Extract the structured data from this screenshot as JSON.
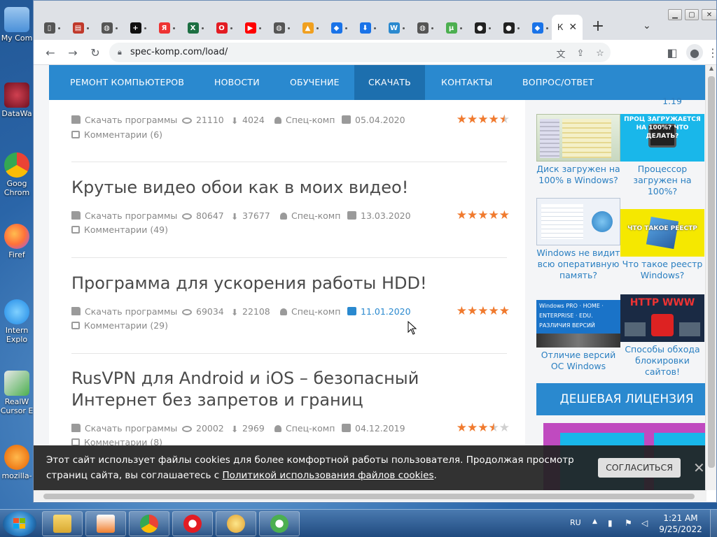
{
  "desktop": {
    "icons": [
      {
        "label": "My Com",
        "color": "#4a90d9"
      },
      {
        "label": "DataWa",
        "color": "#b03040"
      },
      {
        "label": "Goog Chrom",
        "color": "#34a853"
      },
      {
        "label": "Firef",
        "color": "#ff7139"
      },
      {
        "label": "Intern Explo",
        "color": "#1e88e5"
      },
      {
        "label": "RealW Cursor E",
        "color": "#2e7d32"
      },
      {
        "label": "mozilla-",
        "color": "#e66000"
      }
    ]
  },
  "browser": {
    "active_tab_label": "К",
    "url": "spec-komp.com/load/",
    "tabs": [
      {
        "icon": "notebook-icon",
        "color": "#555",
        "glyph": "▯"
      },
      {
        "icon": "books-icon",
        "color": "#c0392b",
        "glyph": "▤"
      },
      {
        "icon": "globe-icon",
        "color": "#555",
        "glyph": "◍"
      },
      {
        "icon": "plus-circle-icon",
        "color": "#111",
        "glyph": "+"
      },
      {
        "icon": "yandex-icon",
        "color": "#e33",
        "glyph": "Я"
      },
      {
        "icon": "excel-icon",
        "color": "#1d6f42",
        "glyph": "X"
      },
      {
        "icon": "opera-icon",
        "color": "#e31c23",
        "glyph": "O"
      },
      {
        "icon": "youtube-icon",
        "color": "#ff0000",
        "glyph": "▶"
      },
      {
        "icon": "globe-icon",
        "color": "#555",
        "glyph": "◍"
      },
      {
        "icon": "image-icon",
        "color": "#f0a020",
        "glyph": "▲"
      },
      {
        "icon": "shield-icon",
        "color": "#1a73e8",
        "glyph": "◆"
      },
      {
        "icon": "download-icon",
        "color": "#1a73e8",
        "glyph": "⬇"
      },
      {
        "icon": "w-logo-icon",
        "color": "#2a89cf",
        "glyph": "W"
      },
      {
        "icon": "globe-icon",
        "color": "#555",
        "glyph": "◍"
      },
      {
        "icon": "utorrent-icon",
        "color": "#4caf50",
        "glyph": "μ"
      },
      {
        "icon": "github-icon",
        "color": "#222",
        "glyph": "●"
      },
      {
        "icon": "github-icon",
        "color": "#222",
        "glyph": "●"
      },
      {
        "icon": "diamond-icon",
        "color": "#1a73e8",
        "glyph": "◆"
      }
    ]
  },
  "site": {
    "nav": [
      "РЕМОНТ КОМПЬЮТЕРОВ",
      "НОВОСТИ",
      "ОБУЧЕНИЕ",
      "СКАЧАТЬ",
      "КОНТАКТЫ",
      "ВОПРОС/ОТВЕТ"
    ],
    "nav_active_index": 3,
    "posts": [
      {
        "title": "",
        "category": "Скачать программы",
        "views": "21110",
        "downloads": "4024",
        "author": "Спец-комп",
        "date": "05.04.2020",
        "comments": "Комментарии (6)",
        "rating": 4.5
      },
      {
        "title": "Крутые видео обои как в моих видео!",
        "category": "Скачать программы",
        "views": "80647",
        "downloads": "37677",
        "author": "Спец-комп",
        "date": "13.03.2020",
        "comments": "Комментарии (49)",
        "rating": 5
      },
      {
        "title": "Программа для ускорения работы HDD!",
        "category": "Скачать программы",
        "views": "69034",
        "downloads": "22108",
        "author": "Спец-комп",
        "date": "11.01.2020",
        "date_highlight": true,
        "comments": "Комментарии (29)",
        "rating": 5
      },
      {
        "title": "RusVPN для Android и iOS – безопасный Интернет без запретов и границ",
        "category": "Скачать программы",
        "views": "20002",
        "downloads": "2969",
        "author": "Спец-комп",
        "date": "04.12.2019",
        "comments": "Комментарии (8)",
        "rating": 3.5
      }
    ],
    "sidebar": {
      "top_caption_right": "1.19",
      "thumbs": [
        {
          "caption": "Диск загружен на 100% в Windows?",
          "img_text": ""
        },
        {
          "caption": "Процессор загружен на 100%?",
          "img_text": "ПРОЦ ЗАГРУЖАЕТСЯ НА 100%? ЧТО ДЕЛАТЬ?"
        },
        {
          "caption": "Windows не видит всю оперативную память?",
          "img_text": ""
        },
        {
          "caption": "Что такое реестр Windows?",
          "img_text": "ЧТО ТАКОЕ РЕЕСТР WINDOWS?"
        },
        {
          "caption": "Отличие версий ОС Windows",
          "img_text": "Windows PRO · HOME · ENTERPRISE · EDU. РАЗЛИЧИЯ ВЕРСИЙ"
        },
        {
          "caption": "Способы обхода блокировки сайтов!",
          "img_text": "HTTP WWW"
        }
      ],
      "license_label": "ДЕШЕВАЯ ЛИЦЕНЗИЯ"
    },
    "cookie": {
      "text_before": "Этот сайт использует файлы cookies для более комфортной работы пользователя. Продолжая просмотр страниц сайта, вы соглашаетесь с ",
      "link": "Политикой использования файлов cookies",
      "text_after": ".",
      "agree": "СОГЛАСИТЬСЯ",
      "close": "✕"
    }
  },
  "taskbar": {
    "apps": [
      {
        "name": "explorer",
        "color": "#f0c040"
      },
      {
        "name": "media-player",
        "color": "#f08030"
      },
      {
        "name": "chrome",
        "color": "#34a853"
      },
      {
        "name": "opera",
        "color": "#e31c23"
      },
      {
        "name": "paint",
        "color": "#e0a030"
      },
      {
        "name": "utorrent",
        "color": "#4caf50"
      }
    ],
    "language": "RU",
    "time": "1:21 AM",
    "date": "9/25/2022"
  }
}
